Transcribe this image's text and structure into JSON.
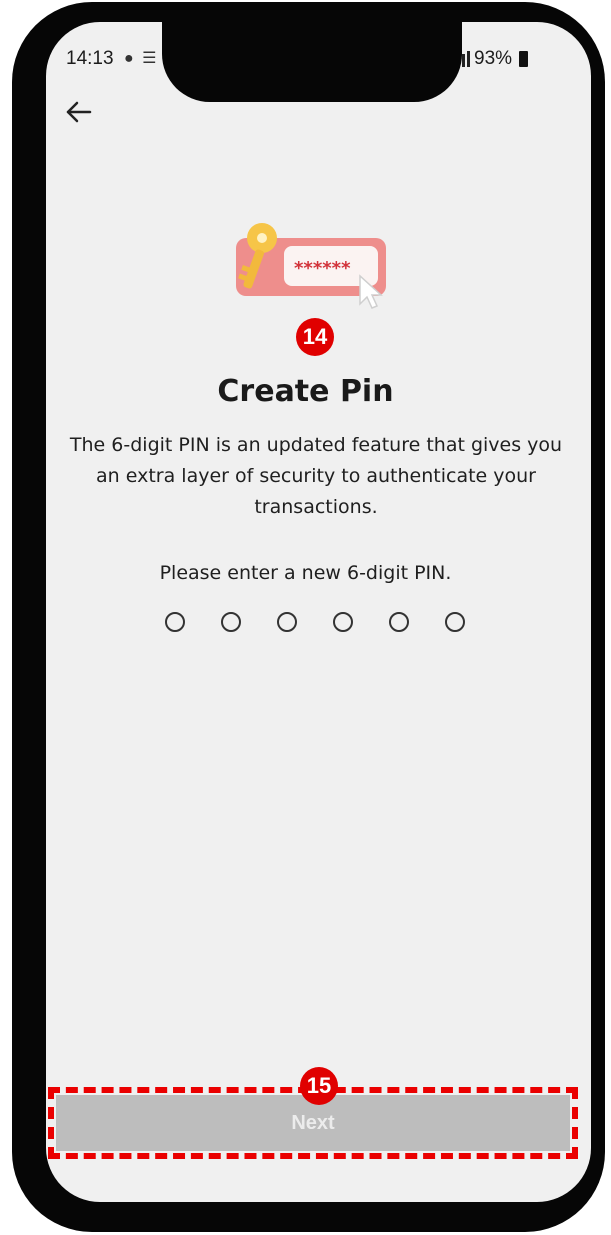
{
  "status_bar": {
    "time": "14:13",
    "left_icons": "● ☰",
    "battery": "93%"
  },
  "icons": {
    "back": "back-arrow-icon",
    "signal": "signal-icon",
    "battery": "battery-icon",
    "illustration": "key-password-illustration"
  },
  "illustration": {
    "password_mask": "******"
  },
  "main": {
    "title": "Create Pin",
    "description": "The 6-digit PIN is an updated feature that gives you an extra layer of security to authenticate your transactions.",
    "instruction": "Please enter a new 6-digit PIN.",
    "pin_length": 6
  },
  "annotations": {
    "step_pin": "14",
    "step_next": "15"
  },
  "footer": {
    "next_label": "Next"
  },
  "colors": {
    "annotation_red": "#ea0000",
    "screen_bg": "#f0f0f0",
    "button_disabled": "#bdbdbd"
  }
}
